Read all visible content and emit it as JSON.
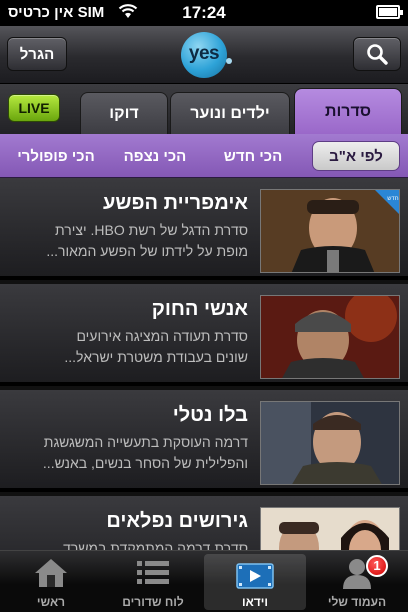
{
  "status_bar": {
    "carrier": "אין כרטיס SIM",
    "time": "17:24"
  },
  "navbar": {
    "roll_label": "הגרל",
    "logo_text": "yes"
  },
  "tabs": [
    {
      "label": "סדרות",
      "active": true
    },
    {
      "label": "ילדים ונוער",
      "active": false
    },
    {
      "label": "דוקו",
      "active": false
    }
  ],
  "live_label": "LIVE",
  "sort_options": [
    {
      "label": "לפי א\"ב",
      "active": true
    },
    {
      "label": "הכי חדש",
      "active": false
    },
    {
      "label": "הכי נצפה",
      "active": false
    },
    {
      "label": "הכי פופולרי",
      "active": false
    }
  ],
  "series": [
    {
      "title": "אימפריית הפשע",
      "line1": "סדרת הדגל של רשת HBO. יצירת",
      "line2": "מופת על לידתו של הפשע המאור...",
      "badge": "חדש"
    },
    {
      "title": "אנשי החוק",
      "line1": "סדרת תעודה המציגה אירועים",
      "line2": "שונים בעבודת משטרת ישראל..."
    },
    {
      "title": "בלו נטלי",
      "line1": "דרמה העוסקת בתעשייה המשגשגת",
      "line2": "והפלילית של הסחר בנשים, באנש..."
    },
    {
      "title": "גירושים נפלאים",
      "line1": "סדרת דרמה המתמקדת במשרד",
      "line2": ""
    }
  ],
  "tabbar": [
    {
      "label": "ראשי",
      "icon": "home-icon"
    },
    {
      "label": "לוח שדורים",
      "icon": "list-icon"
    },
    {
      "label": "וידאו",
      "icon": "video-icon",
      "active": true
    },
    {
      "label": "העמוד שלי",
      "icon": "user-icon",
      "badge": "1"
    }
  ],
  "colors": {
    "accent_purple": "#9a68c9",
    "live_green": "#8cc722",
    "logo_blue": "#2ea3d8"
  }
}
